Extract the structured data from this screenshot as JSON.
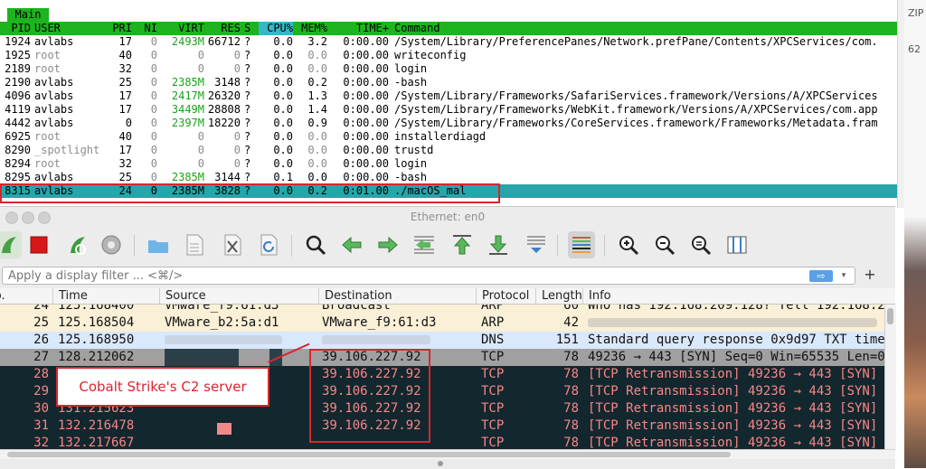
{
  "htop": {
    "tab_label": "Main",
    "header": {
      "pid": "PID",
      "user": "USER",
      "pri": "PRI",
      "ni": "NI",
      "virt": "VIRT",
      "res": "RES",
      "s": "S",
      "cpu": "CPU%",
      "mem": "MEM%",
      "time": "TIME+",
      "command": "Command"
    },
    "rows": [
      {
        "pid": "1924",
        "user": "avlabs",
        "pri": "17",
        "ni": "0",
        "virt": "2493M",
        "res": "66712",
        "s": "?",
        "cpu": "0.0",
        "mem": "3.2",
        "time": "0:00.00",
        "cmd": "/System/Library/PreferencePanes/Network.prefPane/Contents/XPCServices/com."
      },
      {
        "pid": "1925",
        "user": "root",
        "pri": "40",
        "ni": "0",
        "virt": "0",
        "res": "0",
        "s": "?",
        "cpu": "0.0",
        "mem": "0.0",
        "time": "0:00.00",
        "cmd": "writeconfig"
      },
      {
        "pid": "2189",
        "user": "root",
        "pri": "32",
        "ni": "0",
        "virt": "0",
        "res": "0",
        "s": "?",
        "cpu": "0.0",
        "mem": "0.0",
        "time": "0:00.00",
        "cmd": "login"
      },
      {
        "pid": "2190",
        "user": "avlabs",
        "pri": "25",
        "ni": "0",
        "virt": "2385M",
        "res": "3148",
        "s": "?",
        "cpu": "0.0",
        "mem": "0.2",
        "time": "0:00.00",
        "cmd": "-bash"
      },
      {
        "pid": "4096",
        "user": "avlabs",
        "pri": "17",
        "ni": "0",
        "virt": "2417M",
        "res": "26320",
        "s": "?",
        "cpu": "0.0",
        "mem": "1.3",
        "time": "0:00.00",
        "cmd": "/System/Library/Frameworks/SafariServices.framework/Versions/A/XPCServices"
      },
      {
        "pid": "4119",
        "user": "avlabs",
        "pri": "17",
        "ni": "0",
        "virt": "3449M",
        "res": "28808",
        "s": "?",
        "cpu": "0.0",
        "mem": "1.4",
        "time": "0:00.00",
        "cmd": "/System/Library/Frameworks/WebKit.framework/Versions/A/XPCServices/com.app"
      },
      {
        "pid": "4442",
        "user": "avlabs",
        "pri": "0",
        "ni": "0",
        "virt": "2397M",
        "res": "18220",
        "s": "?",
        "cpu": "0.0",
        "mem": "0.9",
        "time": "0:00.00",
        "cmd": "/System/Library/Frameworks/CoreServices.framework/Frameworks/Metadata.fram"
      },
      {
        "pid": "6925",
        "user": "root",
        "pri": "40",
        "ni": "0",
        "virt": "0",
        "res": "0",
        "s": "?",
        "cpu": "0.0",
        "mem": "0.0",
        "time": "0:00.00",
        "cmd": "installerdiagd"
      },
      {
        "pid": "8290",
        "user": "_spotlight",
        "pri": "17",
        "ni": "0",
        "virt": "0",
        "res": "0",
        "s": "?",
        "cpu": "0.0",
        "mem": "0.0",
        "time": "0:00.00",
        "cmd": "trustd"
      },
      {
        "pid": "8294",
        "user": "root",
        "pri": "32",
        "ni": "0",
        "virt": "0",
        "res": "0",
        "s": "?",
        "cpu": "0.0",
        "mem": "0.0",
        "time": "0:00.00",
        "cmd": "login"
      },
      {
        "pid": "8295",
        "user": "avlabs",
        "pri": "25",
        "ni": "0",
        "virt": "2385M",
        "res": "3144",
        "s": "?",
        "cpu": "0.1",
        "mem": "0.0",
        "time": "0:00.00",
        "cmd": "-bash"
      },
      {
        "pid": "8315",
        "user": "avlabs",
        "pri": "24",
        "ni": "0",
        "virt": "2385M",
        "res": "3828",
        "s": "?",
        "cpu": "0.0",
        "mem": "0.2",
        "time": "0:01.00",
        "cmd": "./macOS_mal"
      }
    ]
  },
  "wireshark": {
    "window_title": "Ethernet: en0",
    "filter_placeholder": "Apply a display filter ... <⌘/>",
    "filter_apply": "⇨",
    "filter_dropdown": "▾",
    "add_filter": "+",
    "columns": {
      "no": "No.",
      "time": "Time",
      "source": "Source",
      "destination": "Destination",
      "protocol": "Protocol",
      "length": "Length",
      "info": "Info"
    },
    "packets": [
      {
        "no": "24",
        "time": "125.168400",
        "source": "VMware_f9:61:d3",
        "destination": "Broadcast",
        "protocol": "ARP",
        "length": "60",
        "info": "Who has 192.168.209.128? Tell 192.168.2"
      },
      {
        "no": "25",
        "time": "125.168504",
        "source": "VMware_b2:5a:d1",
        "destination": "VMware_f9:61:d3",
        "protocol": "ARP",
        "length": "42",
        "info": ""
      },
      {
        "no": "26",
        "time": "125.168950",
        "source": "",
        "destination": "",
        "protocol": "DNS",
        "length": "151",
        "info": "Standard query response 0x9d97 TXT time"
      },
      {
        "no": "27",
        "time": "128.212062",
        "source": "",
        "destination": "39.106.227.92",
        "protocol": "TCP",
        "length": "78",
        "info": "49236 → 443 [SYN] Seq=0 Win=65535 Len=0"
      },
      {
        "no": "28",
        "time": "",
        "source": "",
        "destination": "39.106.227.92",
        "protocol": "TCP",
        "length": "78",
        "info": "[TCP Retransmission] 49236 → 443 [SYN]"
      },
      {
        "no": "29",
        "time": "",
        "source": "",
        "destination": "39.106.227.92",
        "protocol": "TCP",
        "length": "78",
        "info": "[TCP Retransmission] 49236 → 443 [SYN]"
      },
      {
        "no": "30",
        "time": "131.215623",
        "source": "",
        "destination": "39.106.227.92",
        "protocol": "TCP",
        "length": "78",
        "info": "[TCP Retransmission] 49236 → 443 [SYN]"
      },
      {
        "no": "31",
        "time": "132.216478",
        "source": "",
        "destination": "39.106.227.92",
        "protocol": "TCP",
        "length": "78",
        "info": "[TCP Retransmission] 49236 → 443 [SYN]"
      },
      {
        "no": "32",
        "time": "132.217667",
        "source": "",
        "destination": "",
        "protocol": "TCP",
        "length": "78",
        "info": "[TCP Retransmission] 49236 → 443 [SYN]"
      }
    ]
  },
  "annotation": {
    "callout_text": "Cobalt Strike's C2 server"
  },
  "desktop": {
    "zip_label": "ZIP",
    "side_number": "62"
  },
  "colors": {
    "htop_green": "#1db41d",
    "htop_selected": "#2aa3ab",
    "retransmission_bg": "#12272e",
    "retransmission_fg": "#f78787",
    "annotation_red": "#d8262e"
  }
}
